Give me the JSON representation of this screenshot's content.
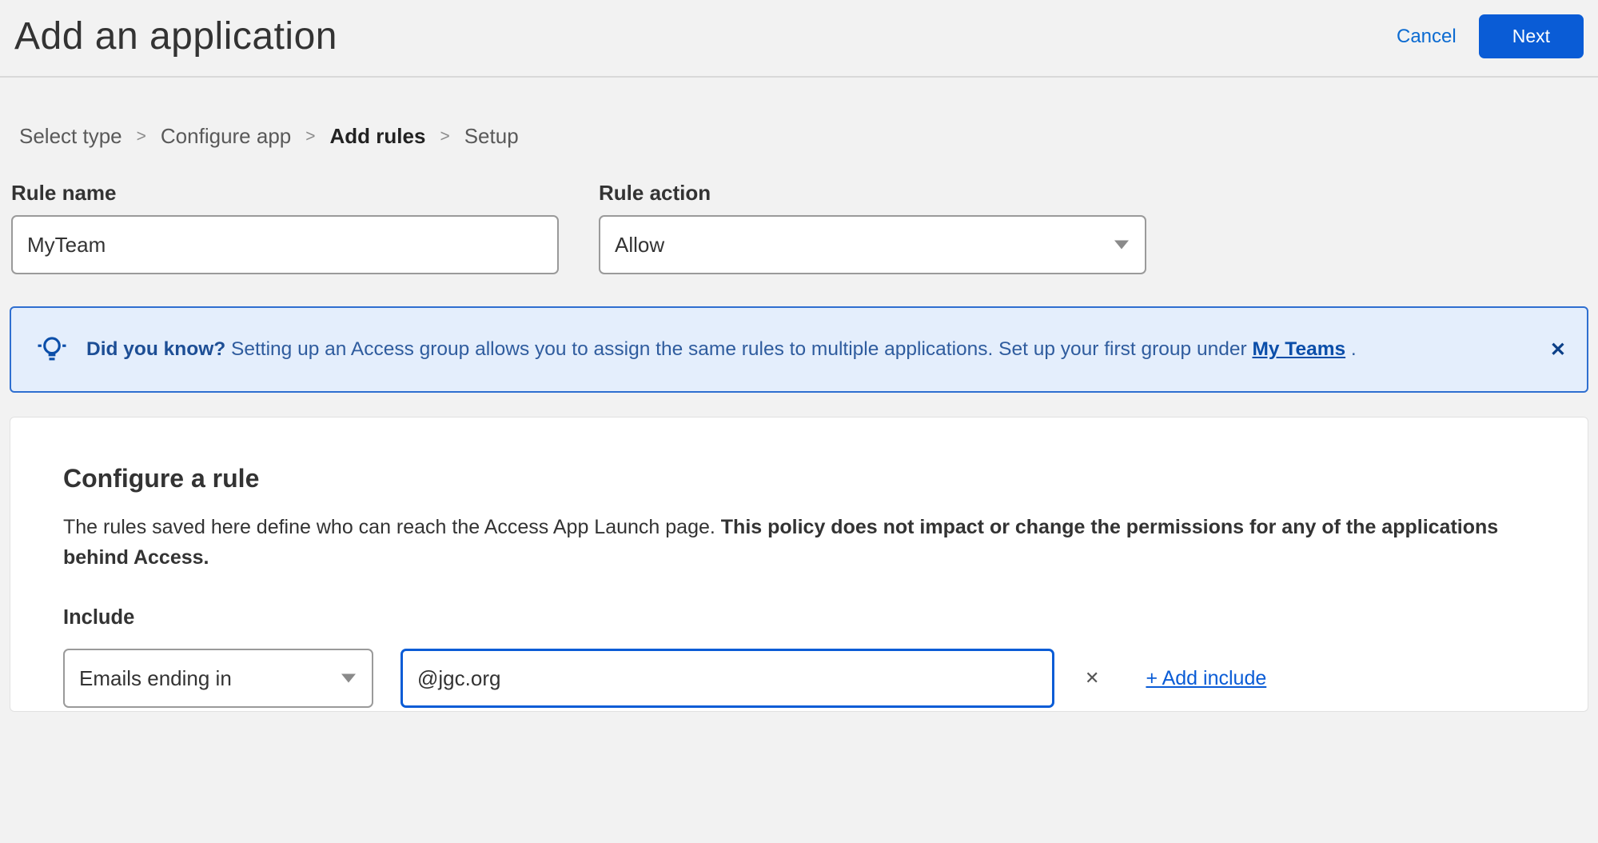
{
  "header": {
    "title": "Add an application",
    "cancel_label": "Cancel",
    "next_label": "Next"
  },
  "breadcrumb": {
    "items": [
      {
        "label": "Select type",
        "active": false
      },
      {
        "label": "Configure app",
        "active": false
      },
      {
        "label": "Add rules",
        "active": true
      },
      {
        "label": "Setup",
        "active": false
      }
    ]
  },
  "form": {
    "rule_name_label": "Rule name",
    "rule_name_value": "MyTeam",
    "rule_action_label": "Rule action",
    "rule_action_value": "Allow"
  },
  "notice": {
    "strong": "Did you know?",
    "text_before": " Setting up an Access group allows you to assign the same rules to multiple applications. Set up your first group under ",
    "link_label": "My Teams",
    "text_after": " ."
  },
  "configure": {
    "title": "Configure a rule",
    "desc_plain": "The rules saved here define who can reach the Access App Launch page. ",
    "desc_bold": "This policy does not impact or change the permissions for any of the applications behind Access.",
    "include_label": "Include",
    "include_selector_value": "Emails ending in",
    "include_value": "@jgc.org",
    "add_include_label": "+ Add include"
  }
}
